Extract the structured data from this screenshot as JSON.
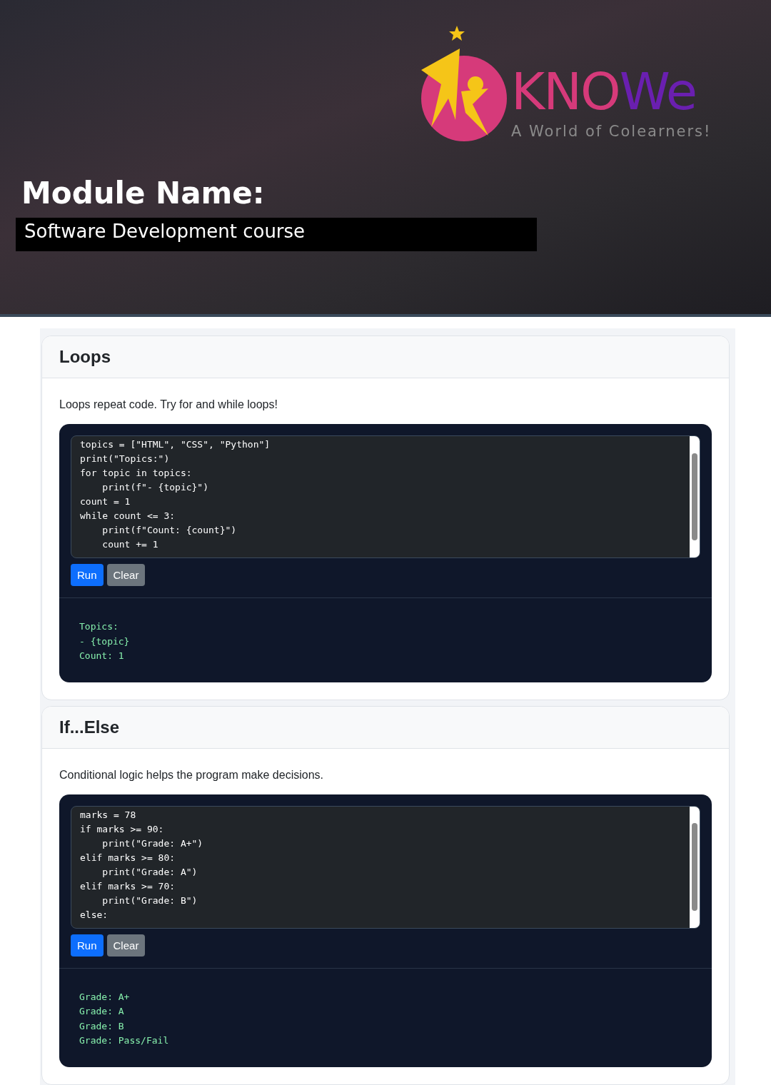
{
  "hero": {
    "logo": {
      "name_start": "KNO",
      "name_end": "We",
      "tagline": "A World of Colearners!"
    },
    "heading": "Module Name:",
    "subheading": "Software Development course"
  },
  "sections": [
    {
      "title": "Loops",
      "description": "Loops repeat code. Try for and while loops!",
      "code": [
        "topics = [\"HTML\", \"CSS\", \"Python\"]",
        "print(\"Topics:\")",
        "for topic in topics:",
        "    print(f\"- {topic}\")",
        "count = 1",
        "while count <= 3:",
        "    print(f\"Count: {count}\")",
        "    count += 1"
      ],
      "buttons": [
        {
          "label": "Run",
          "kind": "primary"
        },
        {
          "label": "Clear",
          "kind": "secondary"
        }
      ],
      "output": [
        "Topics:",
        "- {topic}",
        "Count: 1"
      ]
    },
    {
      "title": "If...Else",
      "description": "Conditional logic helps the program make decisions.",
      "code": [
        "marks = 78",
        "if marks >= 90:",
        "    print(\"Grade: A+\")",
        "elif marks >= 80:",
        "    print(\"Grade: A\")",
        "elif marks >= 70:",
        "    print(\"Grade: B\")",
        "else:"
      ],
      "buttons": [
        {
          "label": "Run",
          "kind": "primary"
        },
        {
          "label": "Clear",
          "kind": "secondary"
        }
      ],
      "output": [
        "Grade: A+",
        "Grade: A",
        "Grade: B",
        "Grade: Pass/Fail"
      ]
    }
  ]
}
